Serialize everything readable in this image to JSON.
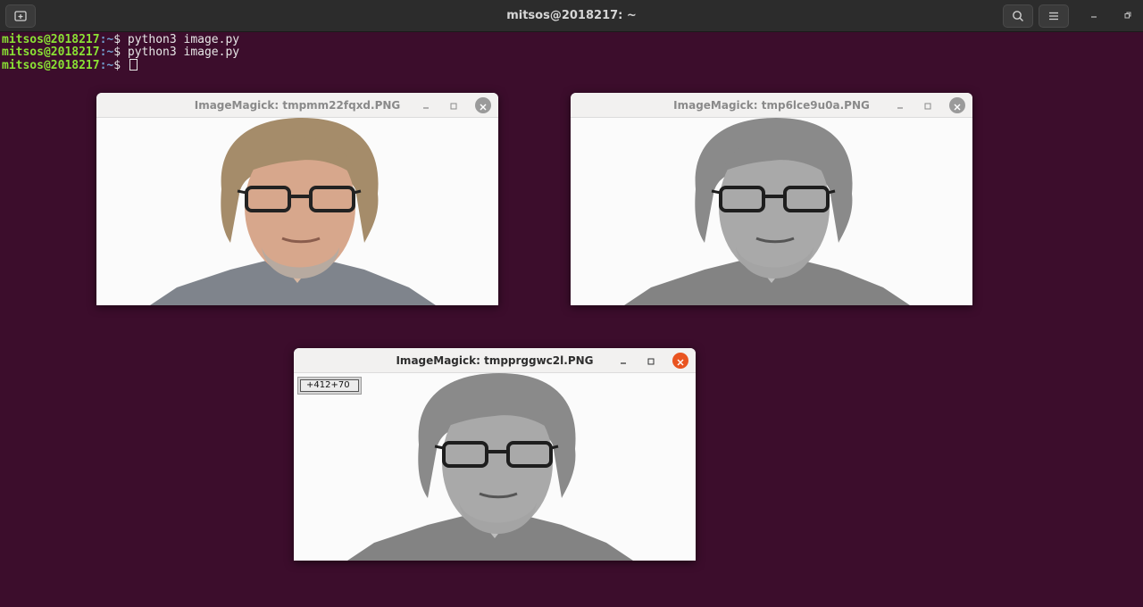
{
  "terminal": {
    "title": "mitsos@2018217: ~",
    "lines": [
      {
        "user": "mitsos@2018217",
        "path": ":~",
        "dollar": "$ ",
        "cmd": "python3 image.py"
      },
      {
        "user": "mitsos@2018217",
        "path": ":~",
        "dollar": "$ ",
        "cmd": "python3 image.py"
      },
      {
        "user": "mitsos@2018217",
        "path": ":~",
        "dollar": "$ ",
        "cmd": ""
      }
    ]
  },
  "windows": [
    {
      "title": "ImageMagick: tmpmm22fqxd.PNG",
      "mode": "color",
      "active": false
    },
    {
      "title": "ImageMagick: tmp6lce9u0a.PNG",
      "mode": "gray",
      "active": false
    },
    {
      "title": "ImageMagick: tmpprggwc2l.PNG",
      "mode": "gray",
      "active": true,
      "coordinates": "+412+70"
    }
  ],
  "colors": {
    "desktop_bg": "#3c0d2c",
    "prompt_user": "#8ae234",
    "prompt_path": "#729fcf",
    "close_active": "#e95420"
  },
  "icons": [
    "new-tab-icon",
    "search-icon",
    "hamburger-menu-icon",
    "minimize-icon",
    "maximize-icon",
    "close-icon"
  ]
}
